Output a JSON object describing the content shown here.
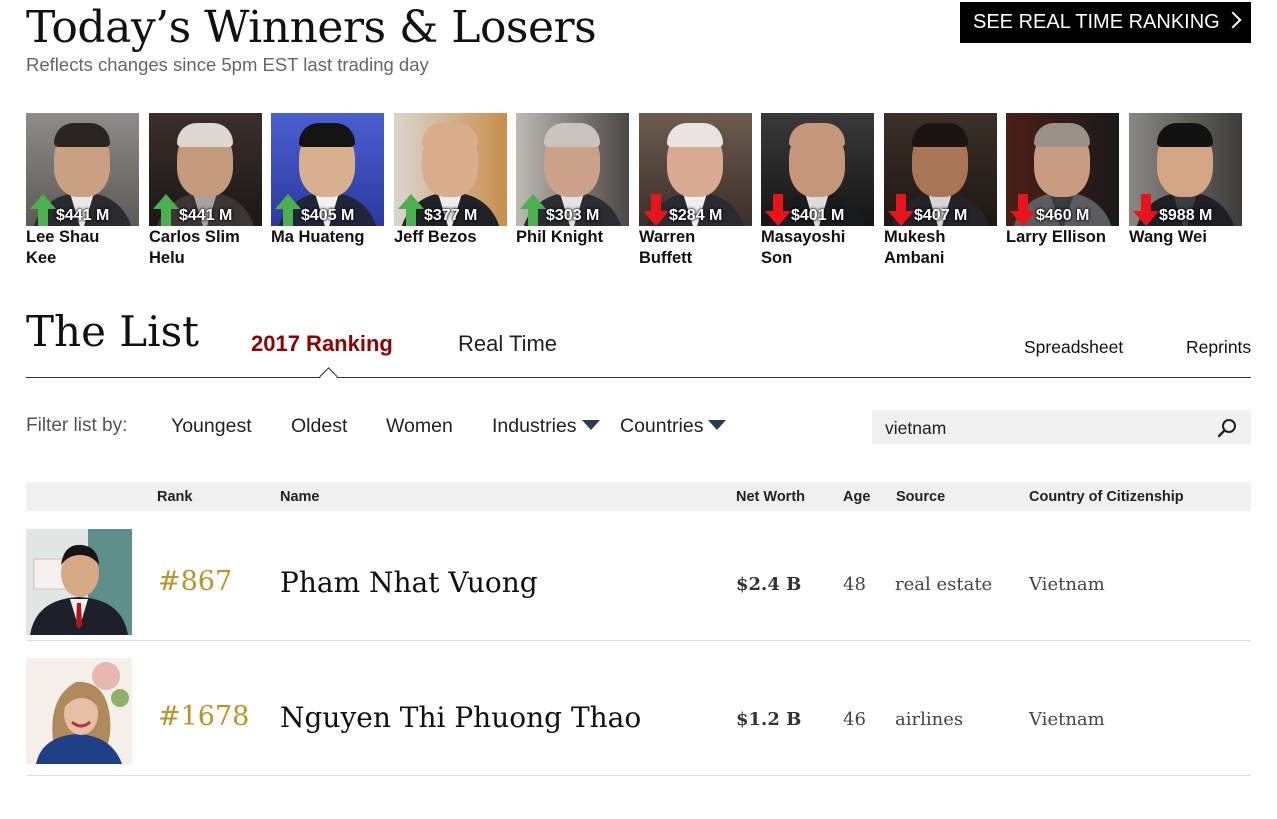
{
  "header": {
    "title": "Today’s Winners & Losers",
    "subtitle": "Reflects changes since 5pm EST last trading day",
    "realtime_button": "SEE REAL TIME RANKING"
  },
  "movers": [
    {
      "name_line1": "Lee Shau",
      "name_line2": "Kee",
      "change": "$441 M",
      "direction": "up"
    },
    {
      "name_line1": "Carlos Slim",
      "name_line2": "Helu",
      "change": "$441 M",
      "direction": "up"
    },
    {
      "name_line1": "Ma Huateng",
      "name_line2": "",
      "change": "$405 M",
      "direction": "up"
    },
    {
      "name_line1": "Jeff Bezos",
      "name_line2": "",
      "change": "$377 M",
      "direction": "up"
    },
    {
      "name_line1": "Phil Knight",
      "name_line2": "",
      "change": "$303 M",
      "direction": "up"
    },
    {
      "name_line1": "Warren",
      "name_line2": "Buffett",
      "change": "$284 M",
      "direction": "down"
    },
    {
      "name_line1": "Masayoshi",
      "name_line2": "Son",
      "change": "$401 M",
      "direction": "down"
    },
    {
      "name_line1": "Mukesh",
      "name_line2": "Ambani",
      "change": "$407 M",
      "direction": "down"
    },
    {
      "name_line1": "Larry Ellison",
      "name_line2": "",
      "change": "$460 M",
      "direction": "down"
    },
    {
      "name_line1": "Wang Wei",
      "name_line2": "",
      "change": "$988 M",
      "direction": "down"
    }
  ],
  "list": {
    "title": "The List",
    "tabs": [
      "2017 Ranking",
      "Real Time"
    ],
    "links": [
      "Spreadsheet",
      "Reprints"
    ]
  },
  "filters": {
    "label": "Filter list by:",
    "items": [
      "Youngest",
      "Oldest",
      "Women",
      "Industries",
      "Countries"
    ],
    "search_value": "vietnam"
  },
  "table": {
    "columns": [
      "Rank",
      "Name",
      "Net Worth",
      "Age",
      "Source",
      "Country of Citizenship"
    ],
    "rows": [
      {
        "rank": "#867",
        "name": "Pham Nhat Vuong",
        "net_worth": "$2.4 B",
        "age": "48",
        "source": "real estate",
        "country": "Vietnam"
      },
      {
        "rank": "#1678",
        "name": "Nguyen Thi Phuong Thao",
        "net_worth": "$1.2 B",
        "age": "46",
        "source": "airlines",
        "country": "Vietnam"
      }
    ]
  },
  "colors": {
    "up_arrow": "#4caf50",
    "down_arrow": "#e8141b",
    "active_tab": "#8b0000",
    "rank_gold": "#b8942e",
    "header_bg": "#f0f0f0"
  }
}
